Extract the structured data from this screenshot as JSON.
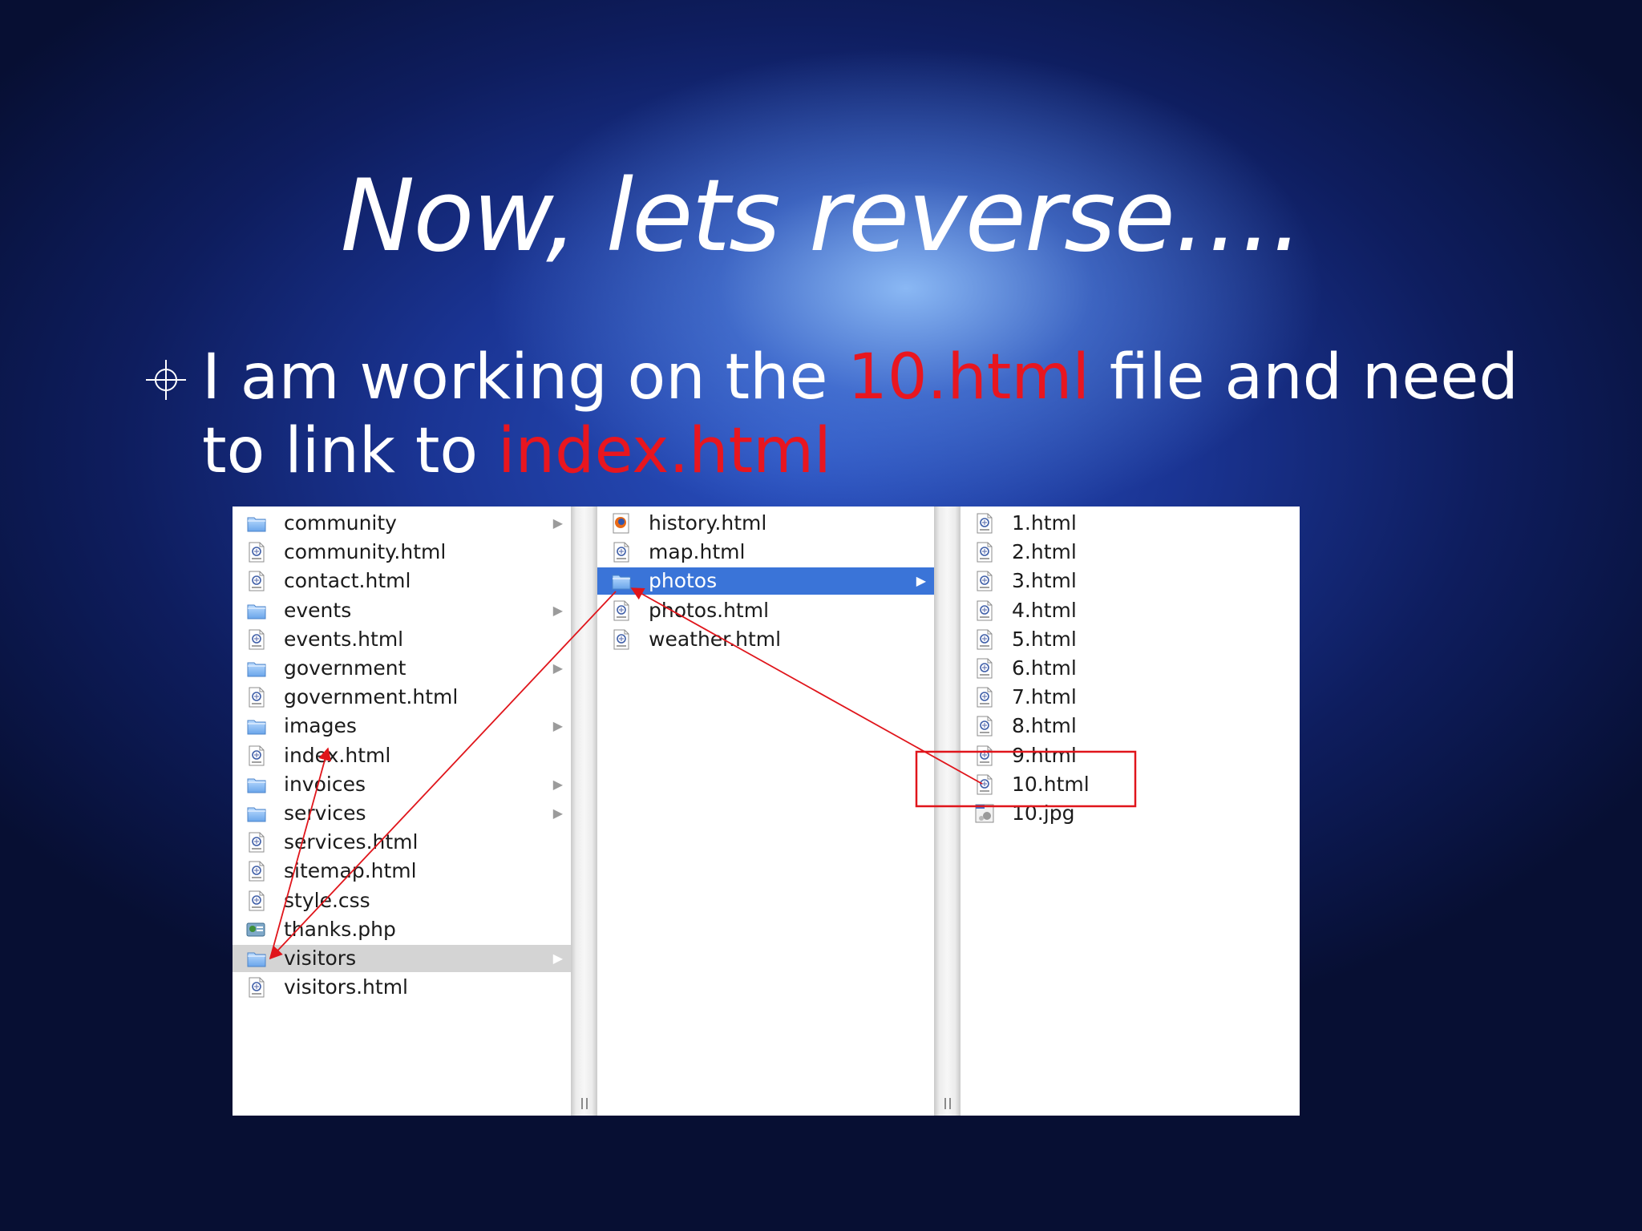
{
  "slide": {
    "title": "Now, lets reverse….",
    "bullet": {
      "part1": "I am working on the ",
      "highlight1": "10.html",
      "part2": " file and need to link to ",
      "highlight2": "index.html"
    },
    "colors": {
      "highlight": "#e8161f",
      "text": "#ffffff",
      "annotation": "#e0151b"
    }
  },
  "finder": {
    "columns": [
      {
        "items": [
          {
            "label": "community",
            "type": "folder",
            "arrow": "▶"
          },
          {
            "label": "community.html",
            "type": "html"
          },
          {
            "label": "contact.html",
            "type": "html"
          },
          {
            "label": "events",
            "type": "folder",
            "arrow": "▶"
          },
          {
            "label": "events.html",
            "type": "html"
          },
          {
            "label": "government",
            "type": "folder",
            "arrow": "▶"
          },
          {
            "label": "government.html",
            "type": "html"
          },
          {
            "label": "images",
            "type": "folder",
            "arrow": "▶"
          },
          {
            "label": "index.html",
            "type": "html"
          },
          {
            "label": "invoices",
            "type": "folder",
            "arrow": "▶"
          },
          {
            "label": "services",
            "type": "folder",
            "arrow": "▶"
          },
          {
            "label": "services.html",
            "type": "html"
          },
          {
            "label": "sitemap.html",
            "type": "html"
          },
          {
            "label": "style.css",
            "type": "html"
          },
          {
            "label": "thanks.php",
            "type": "php"
          },
          {
            "label": "visitors",
            "type": "folder",
            "arrow": "▶",
            "selected": "gray"
          },
          {
            "label": "visitors.html",
            "type": "html"
          }
        ]
      },
      {
        "items": [
          {
            "label": "history.html",
            "type": "firefox"
          },
          {
            "label": "map.html",
            "type": "html"
          },
          {
            "label": "photos",
            "type": "folder",
            "arrow": "▶",
            "selected": "blue"
          },
          {
            "label": "photos.html",
            "type": "html"
          },
          {
            "label": "weather.html",
            "type": "html"
          }
        ]
      },
      {
        "items": [
          {
            "label": "1.html",
            "type": "html"
          },
          {
            "label": "2.html",
            "type": "html"
          },
          {
            "label": "3.html",
            "type": "html"
          },
          {
            "label": "4.html",
            "type": "html"
          },
          {
            "label": "5.html",
            "type": "html"
          },
          {
            "label": "6.html",
            "type": "html"
          },
          {
            "label": "7.html",
            "type": "html"
          },
          {
            "label": "8.html",
            "type": "html"
          },
          {
            "label": "9.html",
            "type": "html"
          },
          {
            "label": "10.html",
            "type": "html"
          },
          {
            "label": "10.jpg",
            "type": "image"
          }
        ]
      }
    ]
  }
}
